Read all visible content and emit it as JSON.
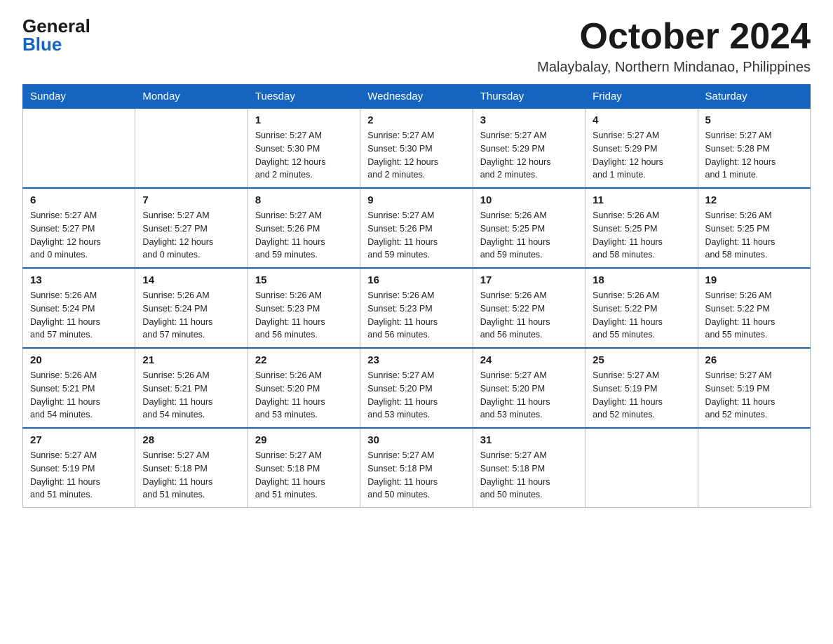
{
  "logo": {
    "general": "General",
    "blue": "Blue"
  },
  "header": {
    "month": "October 2024",
    "location": "Malaybalay, Northern Mindanao, Philippines"
  },
  "weekdays": [
    "Sunday",
    "Monday",
    "Tuesday",
    "Wednesday",
    "Thursday",
    "Friday",
    "Saturday"
  ],
  "weeks": [
    [
      {
        "day": "",
        "info": ""
      },
      {
        "day": "",
        "info": ""
      },
      {
        "day": "1",
        "info": "Sunrise: 5:27 AM\nSunset: 5:30 PM\nDaylight: 12 hours\nand 2 minutes."
      },
      {
        "day": "2",
        "info": "Sunrise: 5:27 AM\nSunset: 5:30 PM\nDaylight: 12 hours\nand 2 minutes."
      },
      {
        "day": "3",
        "info": "Sunrise: 5:27 AM\nSunset: 5:29 PM\nDaylight: 12 hours\nand 2 minutes."
      },
      {
        "day": "4",
        "info": "Sunrise: 5:27 AM\nSunset: 5:29 PM\nDaylight: 12 hours\nand 1 minute."
      },
      {
        "day": "5",
        "info": "Sunrise: 5:27 AM\nSunset: 5:28 PM\nDaylight: 12 hours\nand 1 minute."
      }
    ],
    [
      {
        "day": "6",
        "info": "Sunrise: 5:27 AM\nSunset: 5:27 PM\nDaylight: 12 hours\nand 0 minutes."
      },
      {
        "day": "7",
        "info": "Sunrise: 5:27 AM\nSunset: 5:27 PM\nDaylight: 12 hours\nand 0 minutes."
      },
      {
        "day": "8",
        "info": "Sunrise: 5:27 AM\nSunset: 5:26 PM\nDaylight: 11 hours\nand 59 minutes."
      },
      {
        "day": "9",
        "info": "Sunrise: 5:27 AM\nSunset: 5:26 PM\nDaylight: 11 hours\nand 59 minutes."
      },
      {
        "day": "10",
        "info": "Sunrise: 5:26 AM\nSunset: 5:25 PM\nDaylight: 11 hours\nand 59 minutes."
      },
      {
        "day": "11",
        "info": "Sunrise: 5:26 AM\nSunset: 5:25 PM\nDaylight: 11 hours\nand 58 minutes."
      },
      {
        "day": "12",
        "info": "Sunrise: 5:26 AM\nSunset: 5:25 PM\nDaylight: 11 hours\nand 58 minutes."
      }
    ],
    [
      {
        "day": "13",
        "info": "Sunrise: 5:26 AM\nSunset: 5:24 PM\nDaylight: 11 hours\nand 57 minutes."
      },
      {
        "day": "14",
        "info": "Sunrise: 5:26 AM\nSunset: 5:24 PM\nDaylight: 11 hours\nand 57 minutes."
      },
      {
        "day": "15",
        "info": "Sunrise: 5:26 AM\nSunset: 5:23 PM\nDaylight: 11 hours\nand 56 minutes."
      },
      {
        "day": "16",
        "info": "Sunrise: 5:26 AM\nSunset: 5:23 PM\nDaylight: 11 hours\nand 56 minutes."
      },
      {
        "day": "17",
        "info": "Sunrise: 5:26 AM\nSunset: 5:22 PM\nDaylight: 11 hours\nand 56 minutes."
      },
      {
        "day": "18",
        "info": "Sunrise: 5:26 AM\nSunset: 5:22 PM\nDaylight: 11 hours\nand 55 minutes."
      },
      {
        "day": "19",
        "info": "Sunrise: 5:26 AM\nSunset: 5:22 PM\nDaylight: 11 hours\nand 55 minutes."
      }
    ],
    [
      {
        "day": "20",
        "info": "Sunrise: 5:26 AM\nSunset: 5:21 PM\nDaylight: 11 hours\nand 54 minutes."
      },
      {
        "day": "21",
        "info": "Sunrise: 5:26 AM\nSunset: 5:21 PM\nDaylight: 11 hours\nand 54 minutes."
      },
      {
        "day": "22",
        "info": "Sunrise: 5:26 AM\nSunset: 5:20 PM\nDaylight: 11 hours\nand 53 minutes."
      },
      {
        "day": "23",
        "info": "Sunrise: 5:27 AM\nSunset: 5:20 PM\nDaylight: 11 hours\nand 53 minutes."
      },
      {
        "day": "24",
        "info": "Sunrise: 5:27 AM\nSunset: 5:20 PM\nDaylight: 11 hours\nand 53 minutes."
      },
      {
        "day": "25",
        "info": "Sunrise: 5:27 AM\nSunset: 5:19 PM\nDaylight: 11 hours\nand 52 minutes."
      },
      {
        "day": "26",
        "info": "Sunrise: 5:27 AM\nSunset: 5:19 PM\nDaylight: 11 hours\nand 52 minutes."
      }
    ],
    [
      {
        "day": "27",
        "info": "Sunrise: 5:27 AM\nSunset: 5:19 PM\nDaylight: 11 hours\nand 51 minutes."
      },
      {
        "day": "28",
        "info": "Sunrise: 5:27 AM\nSunset: 5:18 PM\nDaylight: 11 hours\nand 51 minutes."
      },
      {
        "day": "29",
        "info": "Sunrise: 5:27 AM\nSunset: 5:18 PM\nDaylight: 11 hours\nand 51 minutes."
      },
      {
        "day": "30",
        "info": "Sunrise: 5:27 AM\nSunset: 5:18 PM\nDaylight: 11 hours\nand 50 minutes."
      },
      {
        "day": "31",
        "info": "Sunrise: 5:27 AM\nSunset: 5:18 PM\nDaylight: 11 hours\nand 50 minutes."
      },
      {
        "day": "",
        "info": ""
      },
      {
        "day": "",
        "info": ""
      }
    ]
  ]
}
